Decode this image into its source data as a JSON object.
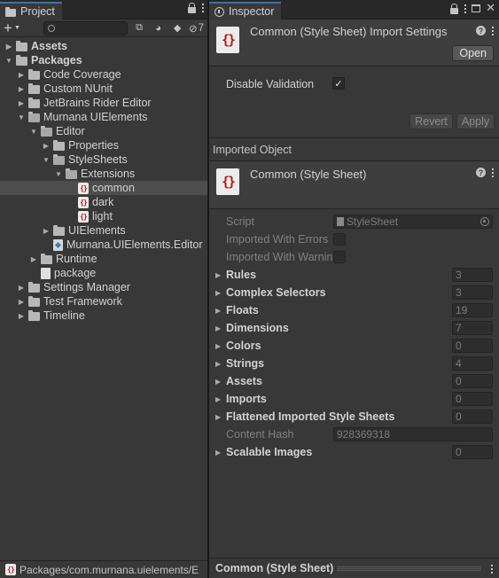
{
  "project": {
    "tab_label": "Project",
    "hidden_count": "7",
    "tree": [
      {
        "label": "Assets",
        "depth": 0,
        "arrow": "right",
        "icon": "folder",
        "bold": true
      },
      {
        "label": "Packages",
        "depth": 0,
        "arrow": "down",
        "icon": "folder",
        "bold": true
      },
      {
        "label": "Code Coverage",
        "depth": 1,
        "arrow": "right",
        "icon": "folder"
      },
      {
        "label": "Custom NUnit",
        "depth": 1,
        "arrow": "right",
        "icon": "folder"
      },
      {
        "label": "JetBrains Rider Editor",
        "depth": 1,
        "arrow": "right",
        "icon": "folder"
      },
      {
        "label": "Murnana UIElements",
        "depth": 1,
        "arrow": "down",
        "icon": "folder-open"
      },
      {
        "label": "Editor",
        "depth": 2,
        "arrow": "down",
        "icon": "folder-open"
      },
      {
        "label": "Properties",
        "depth": 3,
        "arrow": "right",
        "icon": "folder"
      },
      {
        "label": "StyleSheets",
        "depth": 3,
        "arrow": "down",
        "icon": "folder-open"
      },
      {
        "label": "Extensions",
        "depth": 4,
        "arrow": "down",
        "icon": "folder-open"
      },
      {
        "label": "common",
        "depth": 5,
        "arrow": "",
        "icon": "uss",
        "selected": true
      },
      {
        "label": "dark",
        "depth": 5,
        "arrow": "",
        "icon": "uss"
      },
      {
        "label": "light",
        "depth": 5,
        "arrow": "",
        "icon": "uss"
      },
      {
        "label": "UIElements",
        "depth": 3,
        "arrow": "right",
        "icon": "folder"
      },
      {
        "label": "Murnana.UIElements.Editor",
        "depth": 3,
        "arrow": "",
        "icon": "asmdef"
      },
      {
        "label": "Runtime",
        "depth": 2,
        "arrow": "right",
        "icon": "folder"
      },
      {
        "label": "package",
        "depth": 2,
        "arrow": "",
        "icon": "asset"
      },
      {
        "label": "Settings Manager",
        "depth": 1,
        "arrow": "right",
        "icon": "folder"
      },
      {
        "label": "Test Framework",
        "depth": 1,
        "arrow": "right",
        "icon": "folder"
      },
      {
        "label": "Timeline",
        "depth": 1,
        "arrow": "right",
        "icon": "folder"
      }
    ],
    "status_path": "Packages/com.murnana.uielements/E"
  },
  "inspector": {
    "tab_label": "Inspector",
    "header_title": "Common (Style Sheet) Import Settings",
    "open_label": "Open",
    "disable_validation_label": "Disable Validation",
    "disable_validation_checked": "✓",
    "revert_label": "Revert",
    "apply_label": "Apply",
    "imported_object_label": "Imported Object",
    "object_title": "Common (Style Sheet)",
    "script_label": "Script",
    "script_value": "StyleSheet",
    "imported_errors_label": "Imported With Errors",
    "imported_warnings_label": "Imported With Warnin",
    "properties": [
      {
        "label": "Rules",
        "value": "3"
      },
      {
        "label": "Complex Selectors",
        "value": "3"
      },
      {
        "label": "Floats",
        "value": "19"
      },
      {
        "label": "Dimensions",
        "value": "7"
      },
      {
        "label": "Colors",
        "value": "0"
      },
      {
        "label": "Strings",
        "value": "4"
      },
      {
        "label": "Assets",
        "value": "0"
      },
      {
        "label": "Imports",
        "value": "0"
      },
      {
        "label": "Flattened Imported Style Sheets",
        "value": "0"
      }
    ],
    "content_hash_label": "Content Hash",
    "content_hash_value": "928369318",
    "scalable_images_label": "Scalable Images",
    "scalable_images_value": "0",
    "preview_title": "Common (Style Sheet)"
  }
}
